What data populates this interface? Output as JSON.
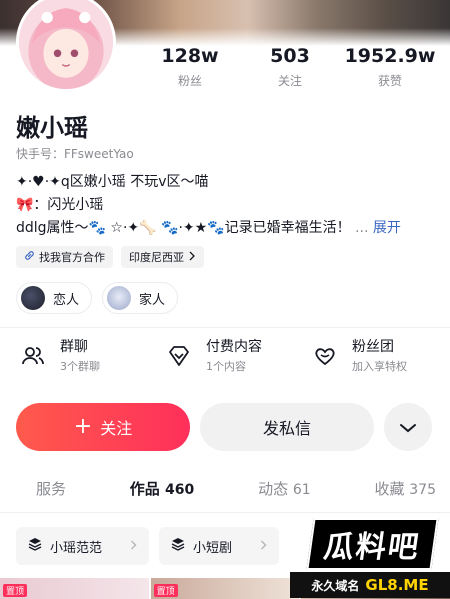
{
  "profile": {
    "name": "嫩小瑶",
    "kuaishou_id": "快手号：FFsweetYao",
    "stats": [
      {
        "value": "128w",
        "label": "粉丝"
      },
      {
        "value": "503",
        "label": "关注"
      },
      {
        "value": "1952.9w",
        "label": "获赞"
      }
    ],
    "bio_lines": [
      "✦·♥·✦q区嫩小瑶 不玩v区～喵",
      "🎀：闪光小瑶",
      "ddlg属性～🐾 ☆·✦🦴 🐾·✦★🐾记录已婚幸福生活！"
    ],
    "bio_more": "...",
    "bio_expand": "展开"
  },
  "chips": [
    {
      "label": "找我官方合作",
      "icon": "link-icon"
    },
    {
      "label": "印度尼西亚",
      "icon": "chevron-right-icon"
    }
  ],
  "relations": [
    {
      "label": "恋人"
    },
    {
      "label": "家人"
    }
  ],
  "features": [
    {
      "title": "群聊",
      "sub": "3个群聊",
      "icon": "group-icon"
    },
    {
      "title": "付费内容",
      "sub": "1个内容",
      "icon": "diamond-icon"
    },
    {
      "title": "粉丝团",
      "sub": "加入享特权",
      "icon": "heart-icon"
    }
  ],
  "actions": {
    "follow": "关注",
    "follow_plus": "+",
    "message": "发私信"
  },
  "tabs": [
    {
      "label": "服务",
      "count": ""
    },
    {
      "label": "作品",
      "count": "460"
    },
    {
      "label": "动态",
      "count": "61"
    },
    {
      "label": "收藏",
      "count": "375"
    }
  ],
  "collections": [
    {
      "label": "小瑶范范"
    },
    {
      "label": "小短剧"
    }
  ],
  "thumbs": {
    "pin": "置顶"
  },
  "watermark": {
    "logo": "瓜料吧",
    "left": "永久域名",
    "right": "GL8.ME"
  },
  "colors": {
    "accent": "#ff2f5b",
    "link": "#3b67c1",
    "muted": "#8a8b91"
  }
}
